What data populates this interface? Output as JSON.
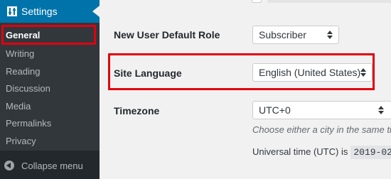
{
  "sidebar": {
    "settings_label": "Settings",
    "items": [
      {
        "label": "General",
        "active": true
      },
      {
        "label": "Writing",
        "active": false
      },
      {
        "label": "Reading",
        "active": false
      },
      {
        "label": "Discussion",
        "active": false
      },
      {
        "label": "Media",
        "active": false
      },
      {
        "label": "Permalinks",
        "active": false
      },
      {
        "label": "Privacy",
        "active": false
      }
    ],
    "collapse_label": "Collapse menu"
  },
  "main": {
    "new_user_role": {
      "label": "New User Default Role",
      "value": "Subscriber"
    },
    "site_language": {
      "label": "Site Language",
      "value": "English (United States)"
    },
    "timezone": {
      "label": "Timezone",
      "value": "UTC+0",
      "description": "Choose either a city in the same ti",
      "utc_label": "Universal time (UTC) is",
      "utc_value": "2019-02-"
    }
  },
  "colors": {
    "sidebar_bg": "#23282d",
    "submenu_bg": "#32373c",
    "accent": "#0073aa",
    "highlight_border": "#e0000e"
  }
}
